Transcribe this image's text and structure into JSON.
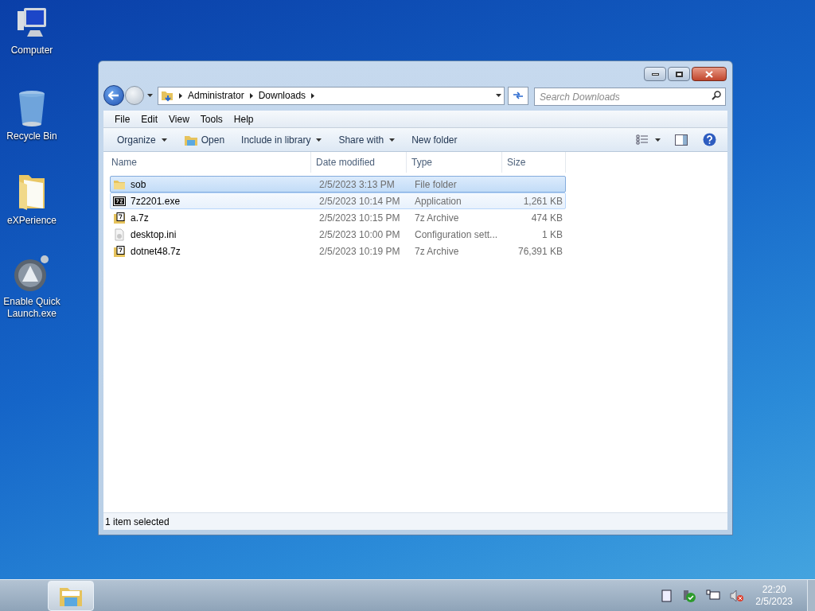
{
  "desktop_icons": [
    {
      "kind": "computer",
      "label": "Computer"
    },
    {
      "kind": "recycle",
      "label": "Recycle Bin"
    },
    {
      "kind": "folder",
      "label": "eXPerience"
    },
    {
      "kind": "app",
      "label": "Enable Quick Launch.exe"
    }
  ],
  "window": {
    "breadcrumb": [
      "Administrator",
      "Downloads"
    ],
    "search": {
      "placeholder": "Search Downloads"
    },
    "menu": [
      "File",
      "Edit",
      "View",
      "Tools",
      "Help"
    ],
    "toolbar": {
      "organize": "Organize",
      "open": "Open",
      "include": "Include in library",
      "share": "Share with",
      "new_folder": "New folder"
    },
    "columns": [
      "Name",
      "Date modified",
      "Type",
      "Size"
    ],
    "rows": [
      {
        "kind": "folder",
        "name": "sob",
        "date": "2/5/2023 3:13 PM",
        "type": "File folder",
        "size": "",
        "selected": true,
        "hovered": false
      },
      {
        "kind": "exe",
        "name": "7z2201.exe",
        "date": "2/5/2023 10:14 PM",
        "type": "Application",
        "size": "1,261 KB",
        "selected": false,
        "hovered": true
      },
      {
        "kind": "archive",
        "name": "a.7z",
        "date": "2/5/2023 10:15 PM",
        "type": "7z Archive",
        "size": "474 KB",
        "selected": false,
        "hovered": false
      },
      {
        "kind": "ini",
        "name": "desktop.ini",
        "date": "2/5/2023 10:00 PM",
        "type": "Configuration sett...",
        "size": "1 KB",
        "selected": false,
        "hovered": false
      },
      {
        "kind": "archive",
        "name": "dotnet48.7z",
        "date": "2/5/2023 10:19 PM",
        "type": "7z Archive",
        "size": "76,391 KB",
        "selected": false,
        "hovered": false
      }
    ],
    "status": "1 item selected"
  },
  "taskbar": {
    "time": "22:20",
    "date": "2/5/2023"
  }
}
